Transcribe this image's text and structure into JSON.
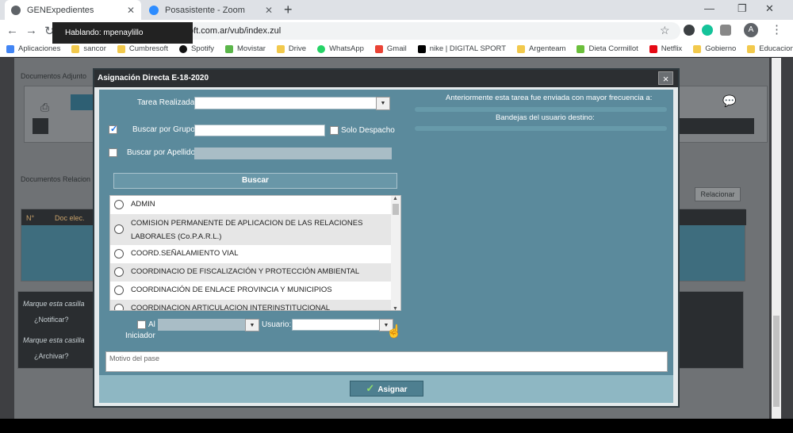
{
  "browser": {
    "tabs": [
      {
        "title": "GENExpedientes",
        "active": true
      },
      {
        "title": "Posasistente - Zoom",
        "active": false
      }
    ],
    "url": "oft.com.ar/vub/index.zul",
    "tooltip": "Hablando: mpenaylillo",
    "avatar_letter": "A",
    "bookmarks": [
      "Aplicaciones",
      "sancor",
      "Cumbresoft",
      "Spotify",
      "Movistar",
      "Drive",
      "WhatsApp",
      "Gmail",
      "nike | DIGITAL SPORT",
      "Argenteam",
      "Dieta Cormillot",
      "Netflix",
      "Gobierno",
      "Educacion"
    ]
  },
  "background": {
    "docs_adjuntos": "Documentos Adjunto",
    "docs_relacionados": "Documentos Relacion",
    "relacionar": "Relacionar",
    "col_n": "N°",
    "col_doc": "Doc elec.",
    "notificar_hint": "Marque esta casilla",
    "notificar": "¿Notificar?",
    "archivar_hint": "Marque esta casilla",
    "archivar": "¿Archivar?"
  },
  "modal": {
    "title": "Asignación Directa E-18-2020",
    "close": "×",
    "tarea_label": "Tarea Realizada:",
    "tarea_value": "",
    "grupo_label": "Buscar por Grupo:",
    "grupo_checked": true,
    "grupo_value": "",
    "solo_despacho": "Solo Despacho",
    "apellido_label": "Buscar por Apellido:",
    "apellido_checked": false,
    "buscar": "Buscar",
    "groups": [
      "ADMIN",
      "COMISION PERMANENTE DE APLICACION DE LAS RELACIONES LABORALES (Co.P.A.R.L.)",
      "COORD.SEÑALAMIENTO VIAL",
      "COORDINACIO DE FISCALIZACIÓN Y PROTECCIÓN AMBIENTAL",
      "COORDINACIÓN DE ENLACE PROVINCIA Y MUNICIPIOS",
      "COORDINACION ARTICULACION INTERINSTITUCIONAL"
    ],
    "al_label": "Al",
    "iniciador_label": "Iniciador",
    "usuario_label": "Usuario:",
    "right_info1": "Anteriormente esta tarea fue enviada con mayor frecuencia a:",
    "right_info2": "Bandejas del usuario destino:",
    "motivo_placeholder": "Motivo del pase",
    "asignar": "Asignar"
  }
}
